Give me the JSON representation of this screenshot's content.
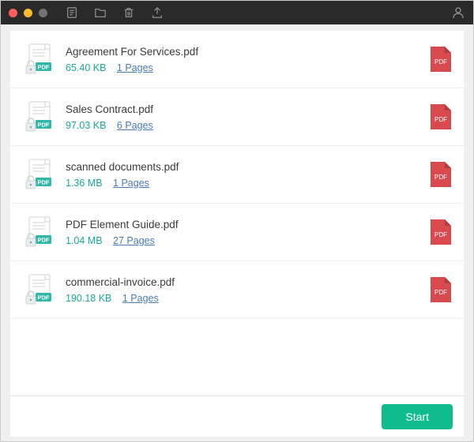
{
  "app": {
    "start_label": "Start"
  },
  "files": [
    {
      "name": "Agreement For Services.pdf",
      "size": "65.40 KB",
      "pages": "1 Pages"
    },
    {
      "name": "Sales Contract.pdf",
      "size": "97.03 KB",
      "pages": "6 Pages"
    },
    {
      "name": "scanned documents.pdf",
      "size": "1.36 MB",
      "pages": "1 Pages"
    },
    {
      "name": "PDF Element Guide.pdf",
      "size": "1.04 MB",
      "pages": "27 Pages"
    },
    {
      "name": "commercial-invoice.pdf",
      "size": "190.18 KB",
      "pages": "1 Pages"
    }
  ],
  "badge_label": "PDF"
}
